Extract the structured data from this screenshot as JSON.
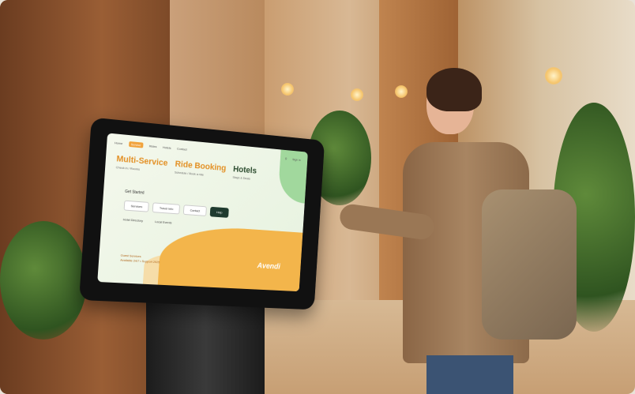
{
  "kiosk": {
    "nav": [
      "Home",
      "Service",
      "Rides",
      "Hotels",
      "Contact",
      "Sign in"
    ],
    "hero": [
      {
        "title": "Multi-Service",
        "sub": "Check in / Rooms"
      },
      {
        "title": "Ride Booking",
        "sub": "Schedule / Book a ride"
      },
      {
        "title": "Hotels",
        "sub": "Stays & Deals"
      }
    ],
    "prompt": "Get Started",
    "buttons": [
      "Services",
      "Travel Info",
      "Contact",
      "Help"
    ],
    "row2": [
      "Hotel Directory",
      "Local Events"
    ],
    "footer": [
      "Guest Services",
      "Available 24/7 • Support 2025"
    ],
    "brand": "Avendi"
  }
}
